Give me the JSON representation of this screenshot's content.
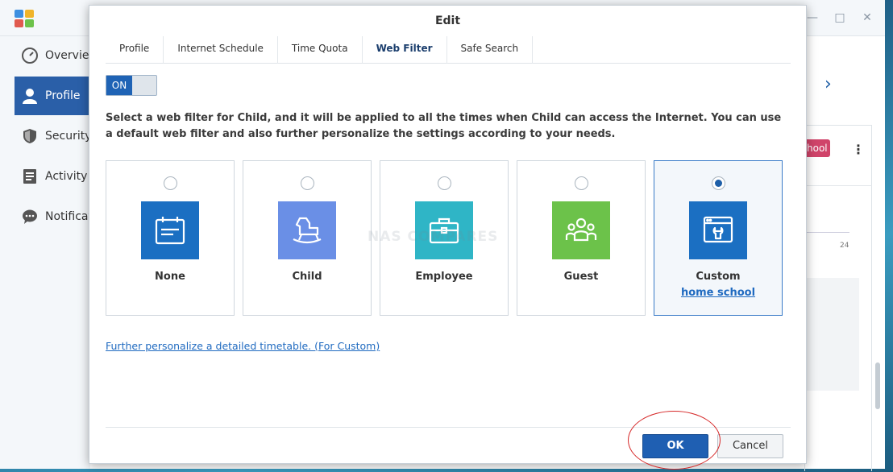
{
  "sidebar": {
    "items": [
      {
        "label": "Overview",
        "icon": "gauge-icon"
      },
      {
        "label": "Profile",
        "icon": "user-icon"
      },
      {
        "label": "Security",
        "icon": "shield-icon"
      },
      {
        "label": "Activity",
        "icon": "list-icon"
      },
      {
        "label": "Notifications",
        "icon": "chat-icon"
      }
    ]
  },
  "background": {
    "badge": "hool",
    "tick": "24"
  },
  "dialog": {
    "title": "Edit",
    "tabs": [
      "Profile",
      "Internet Schedule",
      "Time Quota",
      "Web Filter",
      "Safe Search"
    ],
    "active_tab": "Web Filter",
    "toggle_label": "ON",
    "description": "Select a web filter for Child, and it will be applied to all the times when Child can access the Internet. You can use a default web filter and also further personalize the settings according to your needs.",
    "filters": [
      {
        "label": "None",
        "color": "#1b6fc2",
        "icon": "calendar-icon",
        "selected": false
      },
      {
        "label": "Child",
        "color": "#6a8fe6",
        "icon": "rocking-horse-icon",
        "selected": false
      },
      {
        "label": "Employee",
        "color": "#2fb5c6",
        "icon": "briefcase-icon",
        "selected": false
      },
      {
        "label": "Guest",
        "color": "#6cc24a",
        "icon": "group-icon",
        "selected": false
      },
      {
        "label": "Custom",
        "sublabel": "home school",
        "color": "#1b6fc2",
        "icon": "custom-tool-icon",
        "selected": true
      }
    ],
    "watermark": "NAS COMPARES",
    "timetable_link": "Further personalize a detailed timetable. (For Custom)",
    "ok_label": "OK",
    "cancel_label": "Cancel"
  }
}
